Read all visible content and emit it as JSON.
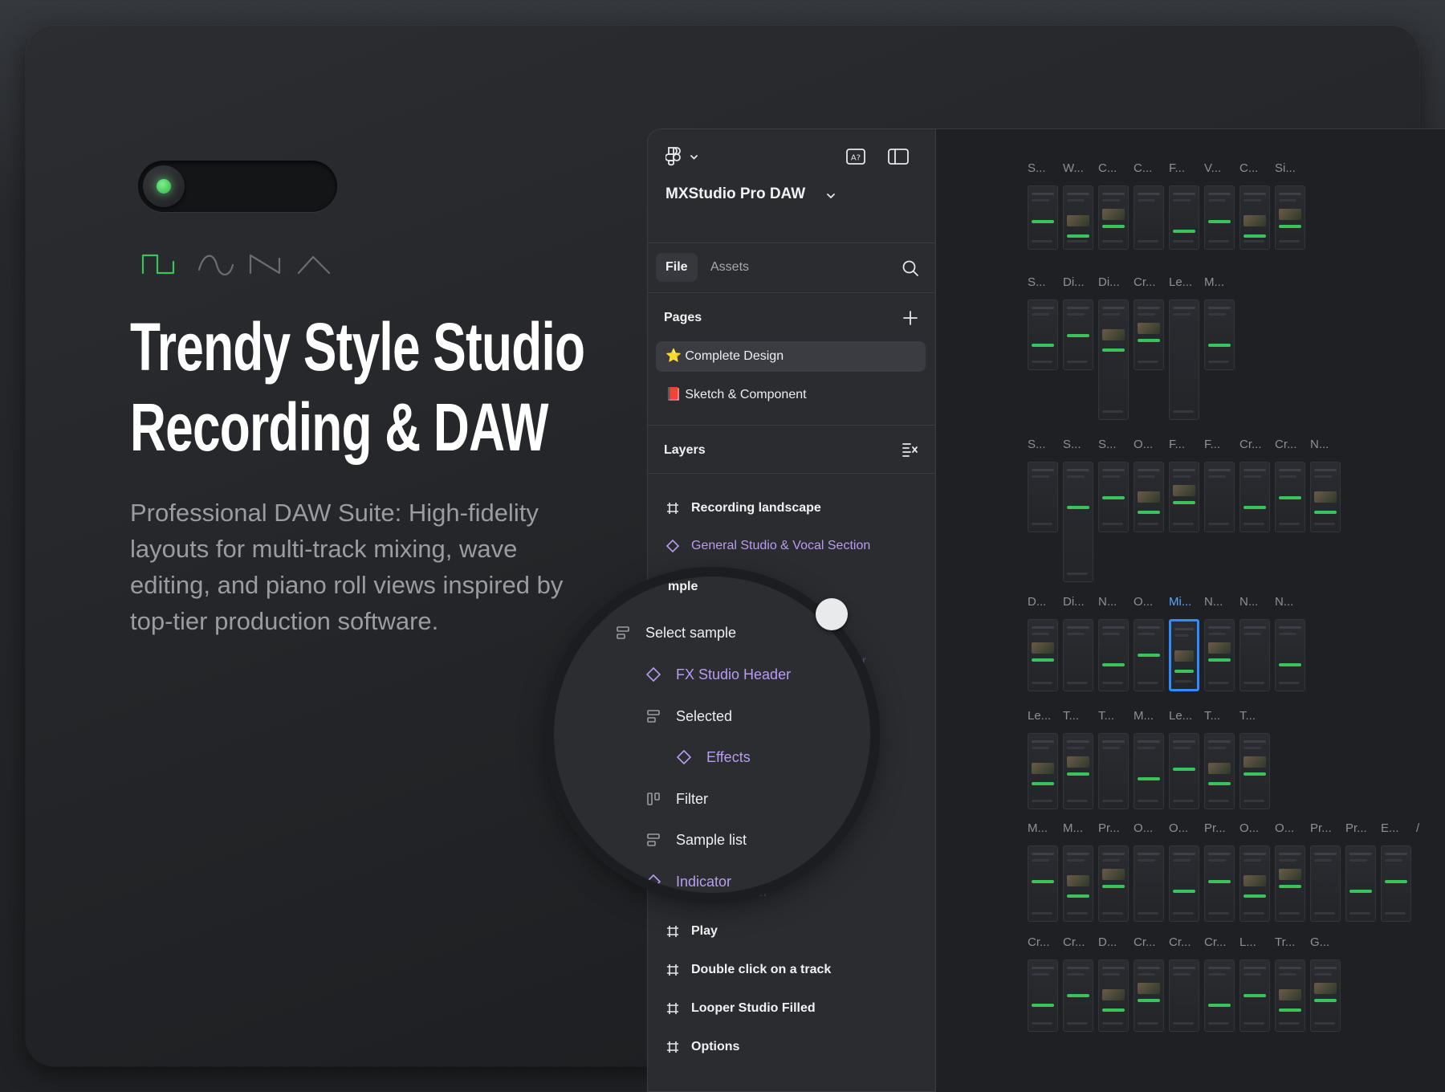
{
  "hero": {
    "title_line1": "Trendy Style Studio",
    "title_line2": "Recording & DAW",
    "description": "Professional DAW Suite: High-fidelity layouts for multi-track mixing, wave editing, and piano roll views inspired by top-tier production software."
  },
  "colors": {
    "accent_green": "#39c35a",
    "component_purple": "#b99cf2",
    "selection_blue": "#2f8cff"
  },
  "panel": {
    "project_name": "MXStudio Pro DAW",
    "tabs": {
      "file": "File",
      "assets": "Assets"
    },
    "pages_label": "Pages",
    "pages": [
      {
        "icon": "⭐",
        "label": "Complete Design"
      },
      {
        "icon": "📕",
        "label": "Sketch & Component"
      }
    ],
    "layers_label": "Layers",
    "layers": [
      {
        "label": "Recording landscape",
        "kind": "frame"
      },
      {
        "label": "General Studio & Vocal Section",
        "kind": "component"
      },
      {
        "label": "Select Sample",
        "kind": "frame"
      },
      {
        "label": "Indicator",
        "kind": "component"
      },
      {
        "label": "Play",
        "kind": "frame"
      },
      {
        "label": "Double click on a track",
        "kind": "frame"
      },
      {
        "label": "Looper Studio Filled",
        "kind": "frame"
      },
      {
        "label": "Options",
        "kind": "frame"
      }
    ],
    "peek_fragments": {
      "header": "ader",
      "t": "t",
      "indicator": "ator"
    }
  },
  "magnifier": {
    "head": "mple",
    "rows": [
      {
        "label": "Select sample",
        "kind": "stack"
      },
      {
        "label": "FX Studio Header",
        "kind": "component"
      },
      {
        "label": "Selected",
        "kind": "stack"
      },
      {
        "label": "Effects",
        "kind": "component"
      },
      {
        "label": "Filter",
        "kind": "columns"
      },
      {
        "label": "Sample list",
        "kind": "stack"
      },
      {
        "label": "Indicator",
        "kind": "component"
      }
    ]
  },
  "canvas": {
    "rows": [
      {
        "labels": [
          "S...",
          "W...",
          "C...",
          "C...",
          "F...",
          "V...",
          "C...",
          "Si..."
        ]
      },
      {
        "labels": [
          "S...",
          "Di...",
          "Di...",
          "Cr...",
          "Le...",
          "M..."
        ]
      },
      {
        "labels": [
          "S...",
          "S...",
          "S...",
          "O...",
          "F...",
          "F...",
          "Cr...",
          "Cr...",
          "N..."
        ]
      },
      {
        "labels": [
          "D...",
          "Di...",
          "N...",
          "O...",
          "Mi...",
          "N...",
          "N...",
          "N..."
        ]
      },
      {
        "labels": [
          "Le...",
          "T...",
          "T...",
          "M...",
          "Le...",
          "T...",
          "T..."
        ]
      },
      {
        "labels": [
          "M...",
          "M...",
          "Pr...",
          "O...",
          "O...",
          "Pr...",
          "O...",
          "O...",
          "Pr...",
          "Pr...",
          "E...",
          "/"
        ]
      },
      {
        "labels": [
          "Cr...",
          "Cr...",
          "D...",
          "Cr...",
          "Cr...",
          "Cr...",
          "L...",
          "Tr...",
          "G..."
        ]
      }
    ]
  }
}
